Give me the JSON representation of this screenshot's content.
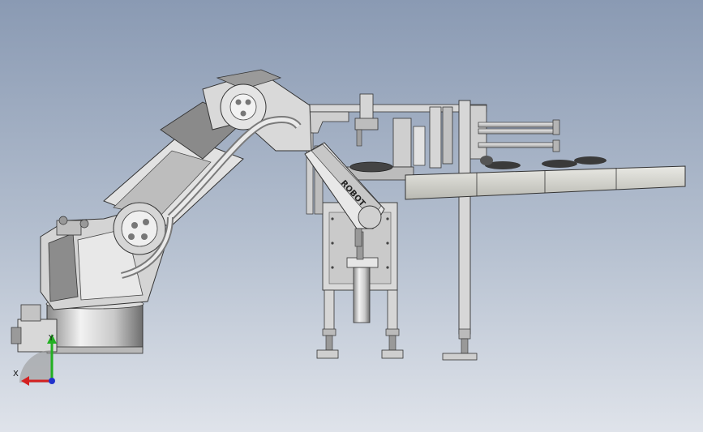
{
  "viewport": {
    "background_top": "#8a9ab3",
    "background_bottom": "#dfe3ea"
  },
  "robot": {
    "arm_label": "ROBOT"
  },
  "triad": {
    "x_label": "X",
    "y_label": "Y",
    "x_color": "#d42020",
    "y_color": "#22b022",
    "z_color": "#2233cc"
  }
}
